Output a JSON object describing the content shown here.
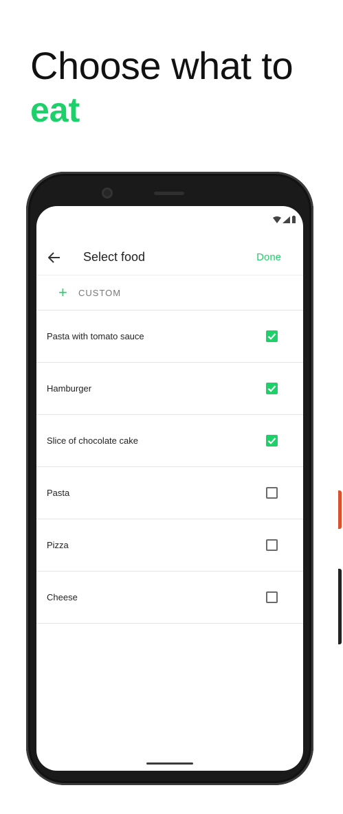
{
  "headline": {
    "line1": "Choose what to",
    "line2": "eat"
  },
  "appbar": {
    "back_icon": "arrow-back-icon",
    "title": "Select food",
    "done_label": "Done"
  },
  "custom": {
    "icon": "plus-icon",
    "label": "CUSTOM"
  },
  "foods": [
    {
      "label": "Pasta with tomato sauce",
      "checked": true
    },
    {
      "label": "Hamburger",
      "checked": true
    },
    {
      "label": "Slice of chocolate cake",
      "checked": true
    },
    {
      "label": "Pasta",
      "checked": false
    },
    {
      "label": "Pizza",
      "checked": false
    },
    {
      "label": "Cheese",
      "checked": false
    }
  ],
  "colors": {
    "accent": "#1ed06a",
    "text": "#222222",
    "frame": "#1a1a1a"
  }
}
